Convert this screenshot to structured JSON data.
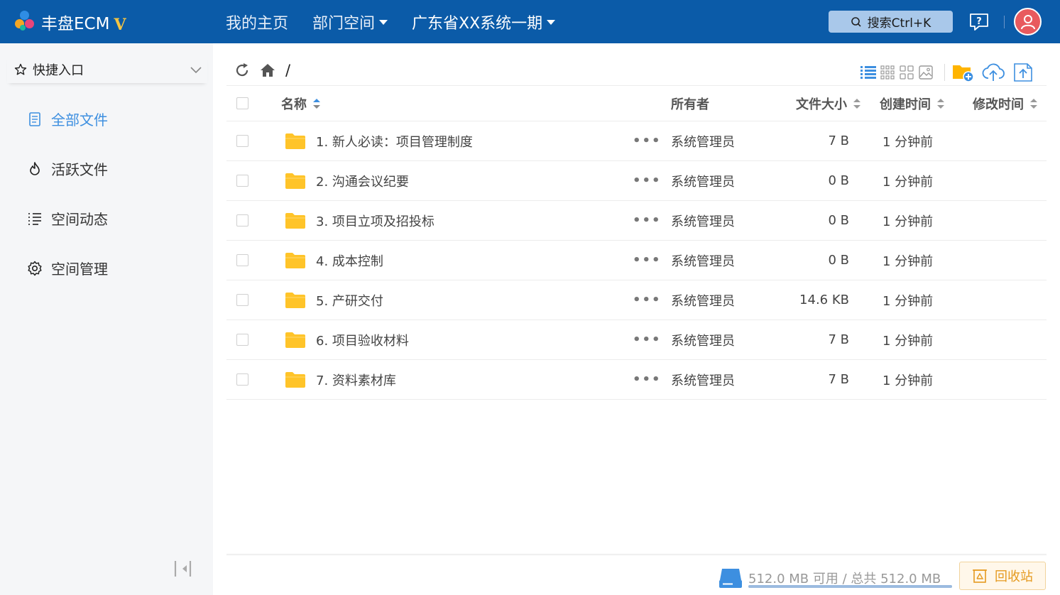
{
  "header": {
    "brand": "丰盘ECM",
    "brand_badge": "V",
    "nav": [
      {
        "label": "我的主页",
        "has_caret": false
      },
      {
        "label": "部门空间",
        "has_caret": true
      },
      {
        "label": "广东省XX系统一期",
        "has_caret": true
      }
    ],
    "search_label": "搜索Ctrl+K",
    "help_icon": "help-icon",
    "avatar_icon": "user-avatar-icon",
    "colors": {
      "bar": "#0b5ba8",
      "search_bg": "#a9c8ea",
      "avatar": "#e85a5e"
    }
  },
  "sidebar": {
    "quick_entry": "快捷入口",
    "items": [
      {
        "label": "全部文件",
        "icon": "file-icon",
        "active": true
      },
      {
        "label": "活跃文件",
        "icon": "flame-icon",
        "active": false
      },
      {
        "label": "空间动态",
        "icon": "activity-list-icon",
        "active": false
      },
      {
        "label": "空间管理",
        "icon": "gear-icon",
        "active": false
      }
    ],
    "accent": "#3d8fe0"
  },
  "main": {
    "path": "/",
    "columns": {
      "name": "名称",
      "owner": "所有者",
      "size": "文件大小",
      "created": "创建时间",
      "modified": "修改时间"
    },
    "rows": [
      {
        "name": "1. 新人必读：项目管理制度",
        "more": "•••",
        "owner": "系统管理员",
        "size": "7 B",
        "created": "1 分钟前",
        "modified": ""
      },
      {
        "name": "2. 沟通会议纪要",
        "more": "•••",
        "owner": "系统管理员",
        "size": "0 B",
        "created": "1 分钟前",
        "modified": ""
      },
      {
        "name": "3. 项目立项及招投标",
        "more": "•••",
        "owner": "系统管理员",
        "size": "0 B",
        "created": "1 分钟前",
        "modified": ""
      },
      {
        "name": "4. 成本控制",
        "more": "•••",
        "owner": "系统管理员",
        "size": "0 B",
        "created": "1 分钟前",
        "modified": ""
      },
      {
        "name": "5. 产研交付",
        "more": "•••",
        "owner": "系统管理员",
        "size": "14.6 KB",
        "created": "1 分钟前",
        "modified": ""
      },
      {
        "name": "6. 项目验收材料",
        "more": "•••",
        "owner": "系统管理员",
        "size": "7 B",
        "created": "1 分钟前",
        "modified": ""
      },
      {
        "name": "7. 资料素材库",
        "more": "•••",
        "owner": "系统管理员",
        "size": "7 B",
        "created": "1 分钟前",
        "modified": ""
      }
    ],
    "folder_color": "#ffc429"
  },
  "footer": {
    "storage_text": "512.0 MB 可用 / 总共 512.0 MB",
    "storage_available_fraction": 1.0,
    "recycle_label": "回收站"
  }
}
